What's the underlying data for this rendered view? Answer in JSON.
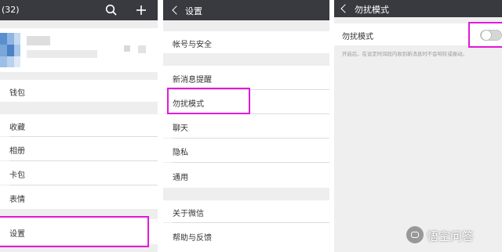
{
  "panel1": {
    "title": "(32)",
    "icons": [
      "search-icon",
      "plus-icon"
    ],
    "items": [
      "钱包",
      "收藏",
      "相册",
      "卡包",
      "表情",
      "设置"
    ]
  },
  "panel2": {
    "title": "设置",
    "items": [
      "帐号与安全",
      "新消息提醒",
      "勿扰模式",
      "聊天",
      "隐私",
      "通用",
      "关于微信",
      "帮助与反馈"
    ]
  },
  "panel3": {
    "title": "勿扰模式",
    "toggle_label": "勿扰模式",
    "description": "开启后，在设定时间段内收到新消息时不会响铃或振动。"
  },
  "watermark": {
    "text": "悟空问答"
  },
  "colors": {
    "topbar": "#393a3f",
    "highlight": "#e21ad8",
    "background": "#eeeeee"
  }
}
